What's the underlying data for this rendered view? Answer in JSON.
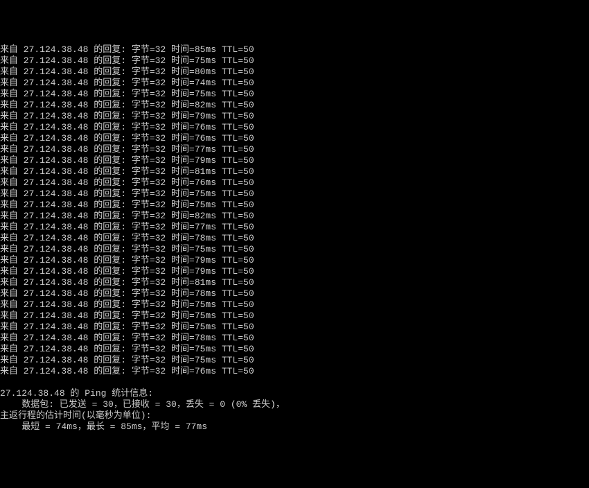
{
  "ping": {
    "ip": "27.124.38.48",
    "reply_prefix": "来自",
    "reply_suffix": "的回复:",
    "bytes_label": "字节",
    "bytes_value": 32,
    "time_label": "时间",
    "ttl_label": "TTL",
    "ttl_value": 50,
    "replies": [
      {
        "time_ms": 85
      },
      {
        "time_ms": 75
      },
      {
        "time_ms": 80
      },
      {
        "time_ms": 74
      },
      {
        "time_ms": 75
      },
      {
        "time_ms": 82
      },
      {
        "time_ms": 79
      },
      {
        "time_ms": 76
      },
      {
        "time_ms": 76
      },
      {
        "time_ms": 77
      },
      {
        "time_ms": 79
      },
      {
        "time_ms": 81
      },
      {
        "time_ms": 76
      },
      {
        "time_ms": 75
      },
      {
        "time_ms": 75
      },
      {
        "time_ms": 82
      },
      {
        "time_ms": 77
      },
      {
        "time_ms": 78
      },
      {
        "time_ms": 75
      },
      {
        "time_ms": 79
      },
      {
        "time_ms": 79
      },
      {
        "time_ms": 81
      },
      {
        "time_ms": 78
      },
      {
        "time_ms": 75
      },
      {
        "time_ms": 75
      },
      {
        "time_ms": 75
      },
      {
        "time_ms": 78
      },
      {
        "time_ms": 75
      },
      {
        "time_ms": 75
      },
      {
        "time_ms": 76
      }
    ],
    "stats": {
      "header": "的 Ping 统计信息:",
      "packets_line_prefix": "    数据包: 已发送 = ",
      "sent": 30,
      "received_label": "，已接收 = ",
      "received": 30,
      "lost_label": "，丢失 = ",
      "lost": 0,
      "loss_pct_text": " (0% 丢失)，",
      "rtt_header": "主返行程的估计时间(以毫秒为单位):",
      "rtt_line_prefix": "    最短 = ",
      "min_ms": 74,
      "max_label": "ms，最长 = ",
      "max_ms": 85,
      "avg_label": "ms，平均 = ",
      "avg_ms": 77,
      "rtt_suffix": "ms"
    }
  }
}
